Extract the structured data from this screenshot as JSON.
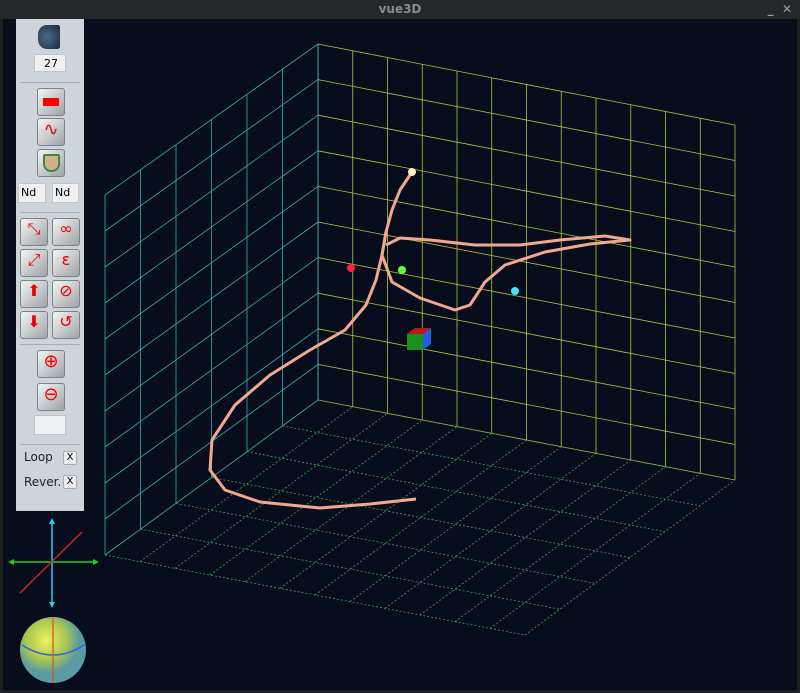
{
  "window": {
    "title": "vue3D",
    "minimize": "_",
    "close": "✕"
  },
  "panel": {
    "counter": "27",
    "field_a": "Nd",
    "field_b": "Nd",
    "blank_field": "",
    "loop_label": "Loop",
    "loop_toggle": "X",
    "reverse_label": "Rever.",
    "reverse_toggle": "X"
  },
  "colors": {
    "background": "#070d1c",
    "trajectory": "#f0a890",
    "back_grid": "#b8c040",
    "left_grid": "#30b0b0",
    "floor_grid": "#40a050"
  }
}
